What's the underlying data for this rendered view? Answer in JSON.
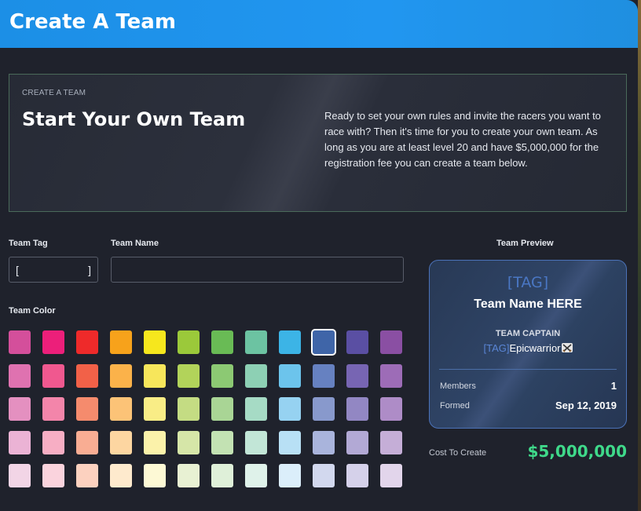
{
  "header": {
    "title": "Create A Team"
  },
  "hero": {
    "eyebrow": "CREATE A TEAM",
    "heading": "Start Your Own Team",
    "description": "Ready to set your own rules and invite the racers you want to race with? Then it's time for you to create your own team. As long as you are at least level 20 and have $5,000,000 for the registration fee you can create a team below."
  },
  "form": {
    "tag_label": "Team Tag",
    "tag_open_bracket": "[",
    "tag_close_bracket": "]",
    "tag_value": "",
    "name_label": "Team Name",
    "name_value": "",
    "color_label": "Team Color",
    "selected_color": "#3f65a8",
    "colors": [
      [
        "#d44f9b",
        "#ec1f7a",
        "#ee2a2a",
        "#f7a21b",
        "#f6e71d",
        "#9bc93a",
        "#69bb55",
        "#6cc3a2",
        "#3cb4e6",
        "#3f65a8",
        "#5a4fa3",
        "#8a4fa3"
      ],
      [
        "#df72b0",
        "#f0588f",
        "#f26148",
        "#fbb24a",
        "#f7e65b",
        "#b2d35a",
        "#8cc973",
        "#8dd0b4",
        "#6cc4ec",
        "#6681c1",
        "#7765b3",
        "#9d6cb7"
      ],
      [
        "#e490c0",
        "#f385aa",
        "#f58b6d",
        "#fcc377",
        "#f9ed86",
        "#c4dc83",
        "#a9d595",
        "#a6dbc5",
        "#96d2f1",
        "#8899cc",
        "#9287c3",
        "#ae8cc7"
      ],
      [
        "#ebb3d5",
        "#f7aec4",
        "#f9ad93",
        "#fdd6a1",
        "#fbf2aa",
        "#d6e6a8",
        "#c3e2b3",
        "#c2e6d7",
        "#b8e0f5",
        "#a9b4dc",
        "#b2a9d5",
        "#c5aed7"
      ],
      [
        "#f2d5e6",
        "#fad3dd",
        "#fcd1bf",
        "#feeacd",
        "#fdf9d5",
        "#e8f1d3",
        "#dff0d9",
        "#dff2ea",
        "#dbeefa",
        "#d2d8ee",
        "#d5d1ea",
        "#e2d5eb"
      ]
    ]
  },
  "preview": {
    "label": "Team Preview",
    "tag": "[TAG]",
    "name": "Team Name HERE",
    "captain_label": "TEAM CAPTAIN",
    "captain_tag": "[TAG]",
    "captain_name": "Epicwarrior",
    "members_label": "Members",
    "members_value": "1",
    "formed_label": "Formed",
    "formed_value": "Sep 12, 2019"
  },
  "cost": {
    "label": "Cost To Create",
    "value": "$5,000,000"
  }
}
